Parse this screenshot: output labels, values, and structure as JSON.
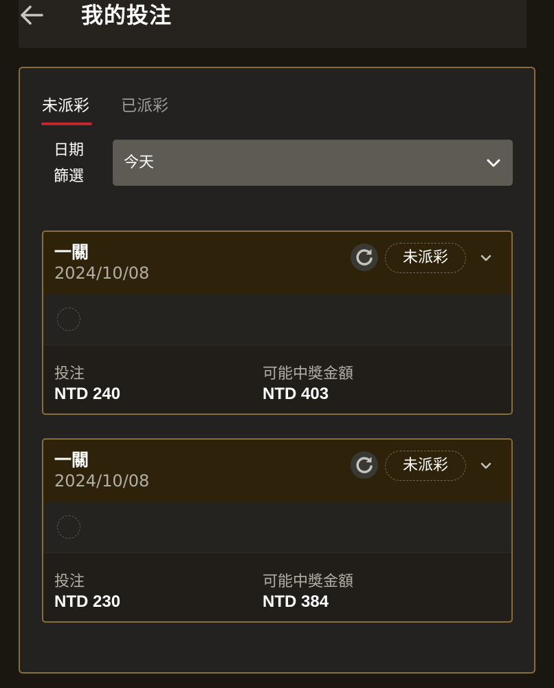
{
  "header": {
    "title": "我的投注",
    "back_icon": "arrow-left-icon"
  },
  "tabs": [
    {
      "label": "未派彩",
      "active": true
    },
    {
      "label": "已派彩",
      "active": false
    }
  ],
  "filter": {
    "label_line1": "日期",
    "label_line2": "篩選",
    "selected": "今天"
  },
  "bets": [
    {
      "title": "一關",
      "date": "2024/10/08",
      "status": "未派彩",
      "stake_label": "投注",
      "stake": "NTD 240",
      "payout_label": "可能中獎金額",
      "payout": "NTD 403"
    },
    {
      "title": "一關",
      "date": "2024/10/08",
      "status": "未派彩",
      "stake_label": "投注",
      "stake": "NTD 230",
      "payout_label": "可能中獎金額",
      "payout": "NTD 384"
    }
  ],
  "colors": {
    "accent_border": "#8a6d33",
    "tab_underline": "#c1272d",
    "card_header": "#2e230a"
  }
}
